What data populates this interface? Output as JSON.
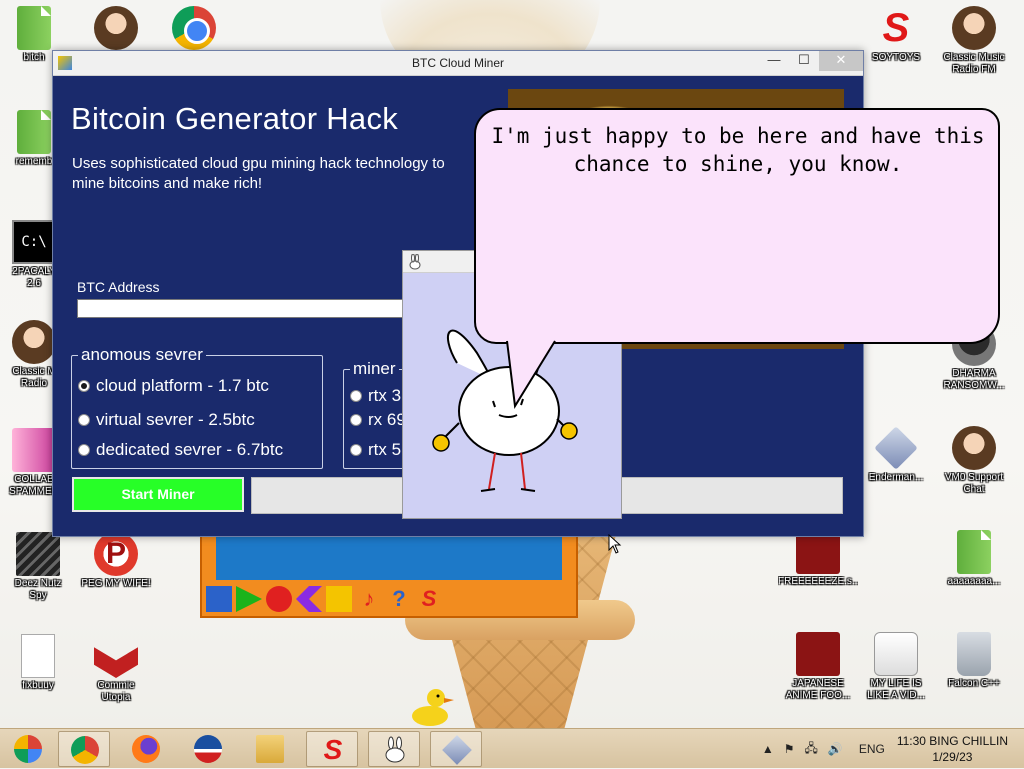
{
  "window": {
    "title": "BTC Cloud Miner",
    "minimize": "—",
    "maximize": "☐",
    "close": "✕"
  },
  "app": {
    "heading": "Bitcoin Generator Hack",
    "subtitle": "Uses sophisticated cloud gpu mining hack technology to mine bitcoins and make rich!",
    "address_label": "BTC Address",
    "address_value": "",
    "server_group": {
      "legend": "anomous sevrer",
      "options": [
        {
          "label": "cloud platform - 1.7 btc",
          "selected": true
        },
        {
          "label": "virtual sevrer - 2.5btc",
          "selected": false
        },
        {
          "label": "dedicated sevrer - 6.7btc",
          "selected": false
        }
      ]
    },
    "miner_group": {
      "legend": "miner",
      "options": [
        {
          "label": "rtx 3",
          "selected": false
        },
        {
          "label": "rx 69",
          "selected": false
        },
        {
          "label": "rtx 5",
          "selected": false
        }
      ]
    },
    "start_button": "Start Miner",
    "progress": 0
  },
  "speech": {
    "text": "I'm just happy to be here and have this chance to shine, you know."
  },
  "desktop_icons": [
    {
      "label": "bitch",
      "icon": "green-file-icon"
    },
    {
      "label": "rememb",
      "icon": "green-file-icon"
    },
    {
      "label": "2PACALY\n2.6",
      "icon": "command-prompt-icon"
    },
    {
      "label": "Classic M\nRadio",
      "icon": "portrait-icon"
    },
    {
      "label": "COLLAB\nSPAMMER",
      "icon": "gift-icon"
    },
    {
      "label": "Deez Nutz\nSpy",
      "icon": "stack-icon"
    },
    {
      "label": "PEG MY WIFE!",
      "icon": "pegasus-icon"
    },
    {
      "label": "fixbuuy",
      "icon": "doc-icon"
    },
    {
      "label": "Commie\nUtopia",
      "icon": "bolt-icon"
    },
    {
      "label": "SOYTOYS",
      "icon": "red-s-icon"
    },
    {
      "label": "Classic Music\nRadio FM",
      "icon": "portrait-icon"
    },
    {
      "label": "DHARMA\nRANSOMW...",
      "icon": "bot-icon"
    },
    {
      "label": "Enderman...",
      "icon": "cube-icon"
    },
    {
      "label": "VM0 Support\nChat",
      "icon": "support-person-icon"
    },
    {
      "label": "FREEEEEEZE.s...",
      "icon": "flash-icon"
    },
    {
      "label": "aaaaaaaa...",
      "icon": "green-file-icon"
    },
    {
      "label": "JAPANESE\nANIME FOO...",
      "icon": "flash-icon"
    },
    {
      "label": "MY LIFE IS\nLIKE A VID...",
      "icon": "gamepad-icon"
    },
    {
      "label": "Falcon C++",
      "icon": "recycle-bin-icon"
    }
  ],
  "taskbar": {
    "items": [
      "start-icon",
      "chrome-icon",
      "firefox-icon",
      "obama-icon",
      "explorer-icon",
      "soytoys-icon",
      "bunny-icon",
      "cube-icon"
    ],
    "tray_arrow": "▲",
    "tray_flag": "⚑",
    "tray_network": "🖧",
    "tray_volume": "🔊",
    "language": "ENG",
    "time": "11:30 BING CHILLIN",
    "date": "1/29/23"
  }
}
